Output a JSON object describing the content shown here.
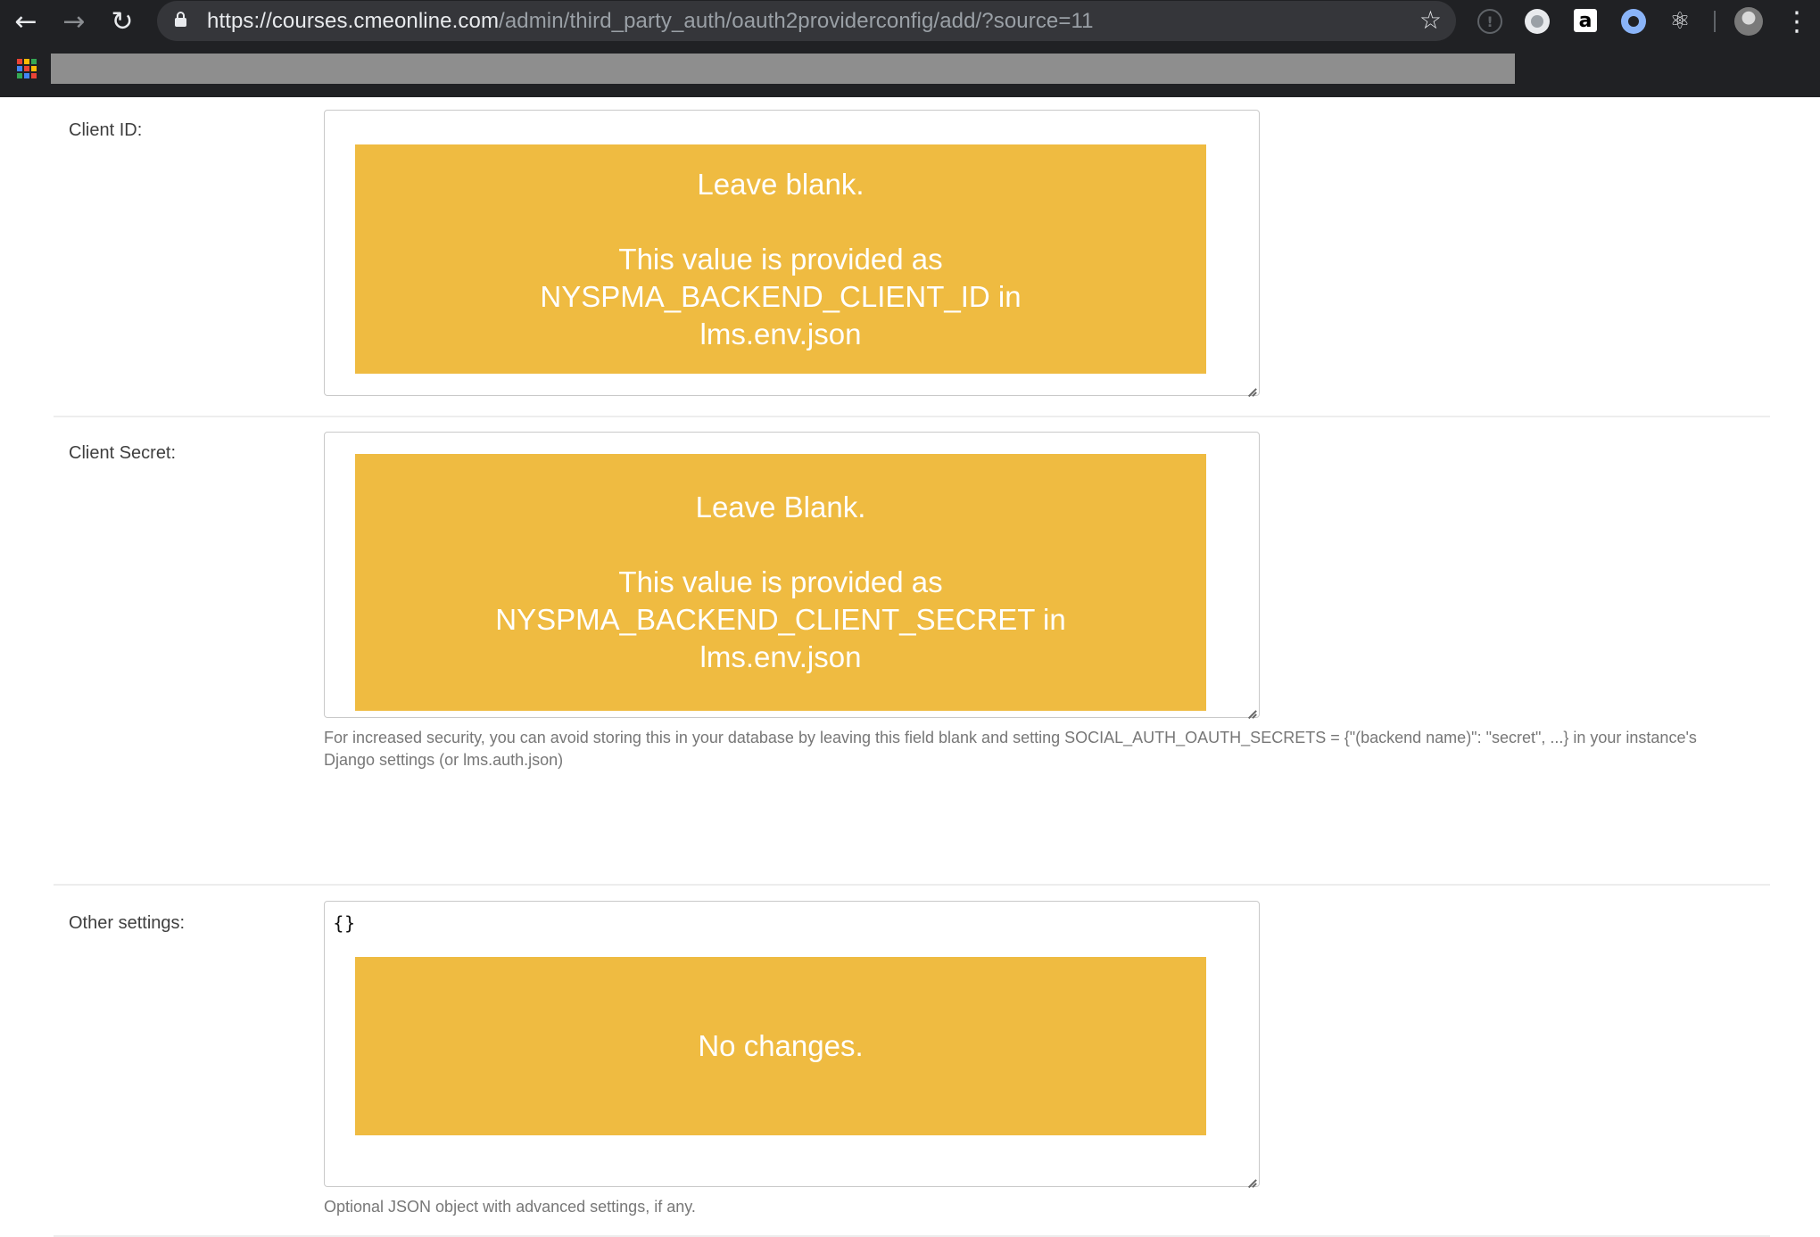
{
  "browser": {
    "url_host": "https://courses.cmeonline.com",
    "url_path": "/admin/third_party_auth/oauth2providerconfig/add/?source=11",
    "icons": {
      "back": "arrow-left-icon",
      "forward": "arrow-right-icon",
      "reload": "reload-icon",
      "lock": "lock-icon",
      "bookmark": "star-icon",
      "extensions": [
        "info-icon",
        "circle-extension-icon",
        "amazon-icon",
        "ring-extension-icon",
        "atom-icon"
      ],
      "profile": "avatar",
      "menu": "kebab-menu-icon",
      "apps": "apps-grid-icon"
    },
    "glyphs": {
      "back": "←",
      "forward": "→",
      "reload": "↻",
      "star": "☆",
      "info": "!",
      "amazon": "a",
      "atom": "⚛",
      "menu": "⋮"
    }
  },
  "form": {
    "client_id": {
      "label": "Client ID:",
      "note_line1": "Leave blank.",
      "note_line2": "This value is provided as",
      "note_line3": "NYSPMA_BACKEND_CLIENT_ID in",
      "note_line4": "lms.env.json"
    },
    "client_secret": {
      "label": "Client Secret:",
      "note_line1": "Leave Blank.",
      "note_line2": "This value is provided as",
      "note_line3": "NYSPMA_BACKEND_CLIENT_SECRET in",
      "note_line4": "lms.env.json",
      "help_line1": "For increased security, you can avoid storing this in your database by leaving this field blank and setting SOCIAL_AUTH_OAUTH_SECRETS = {\"(backend name)\": \"secret\", ...} in your instance's",
      "help_line2": "Django settings (or lms.auth.json)"
    },
    "other_settings": {
      "label": "Other settings:",
      "value": "{}",
      "note": "No changes.",
      "help": "Optional JSON object with advanced settings, if any."
    }
  },
  "colors": {
    "chrome_bg": "#202124",
    "omnibox_bg": "#35363a",
    "annotation_yellow": "#efbb41",
    "redaction_gray": "#8e8e8e",
    "apps_dots": [
      "#ea4335",
      "#fbbc05",
      "#34a853",
      "#4285f4",
      "#ea4335",
      "#fbbc05",
      "#34a853",
      "#4285f4",
      "#ea4335"
    ]
  }
}
